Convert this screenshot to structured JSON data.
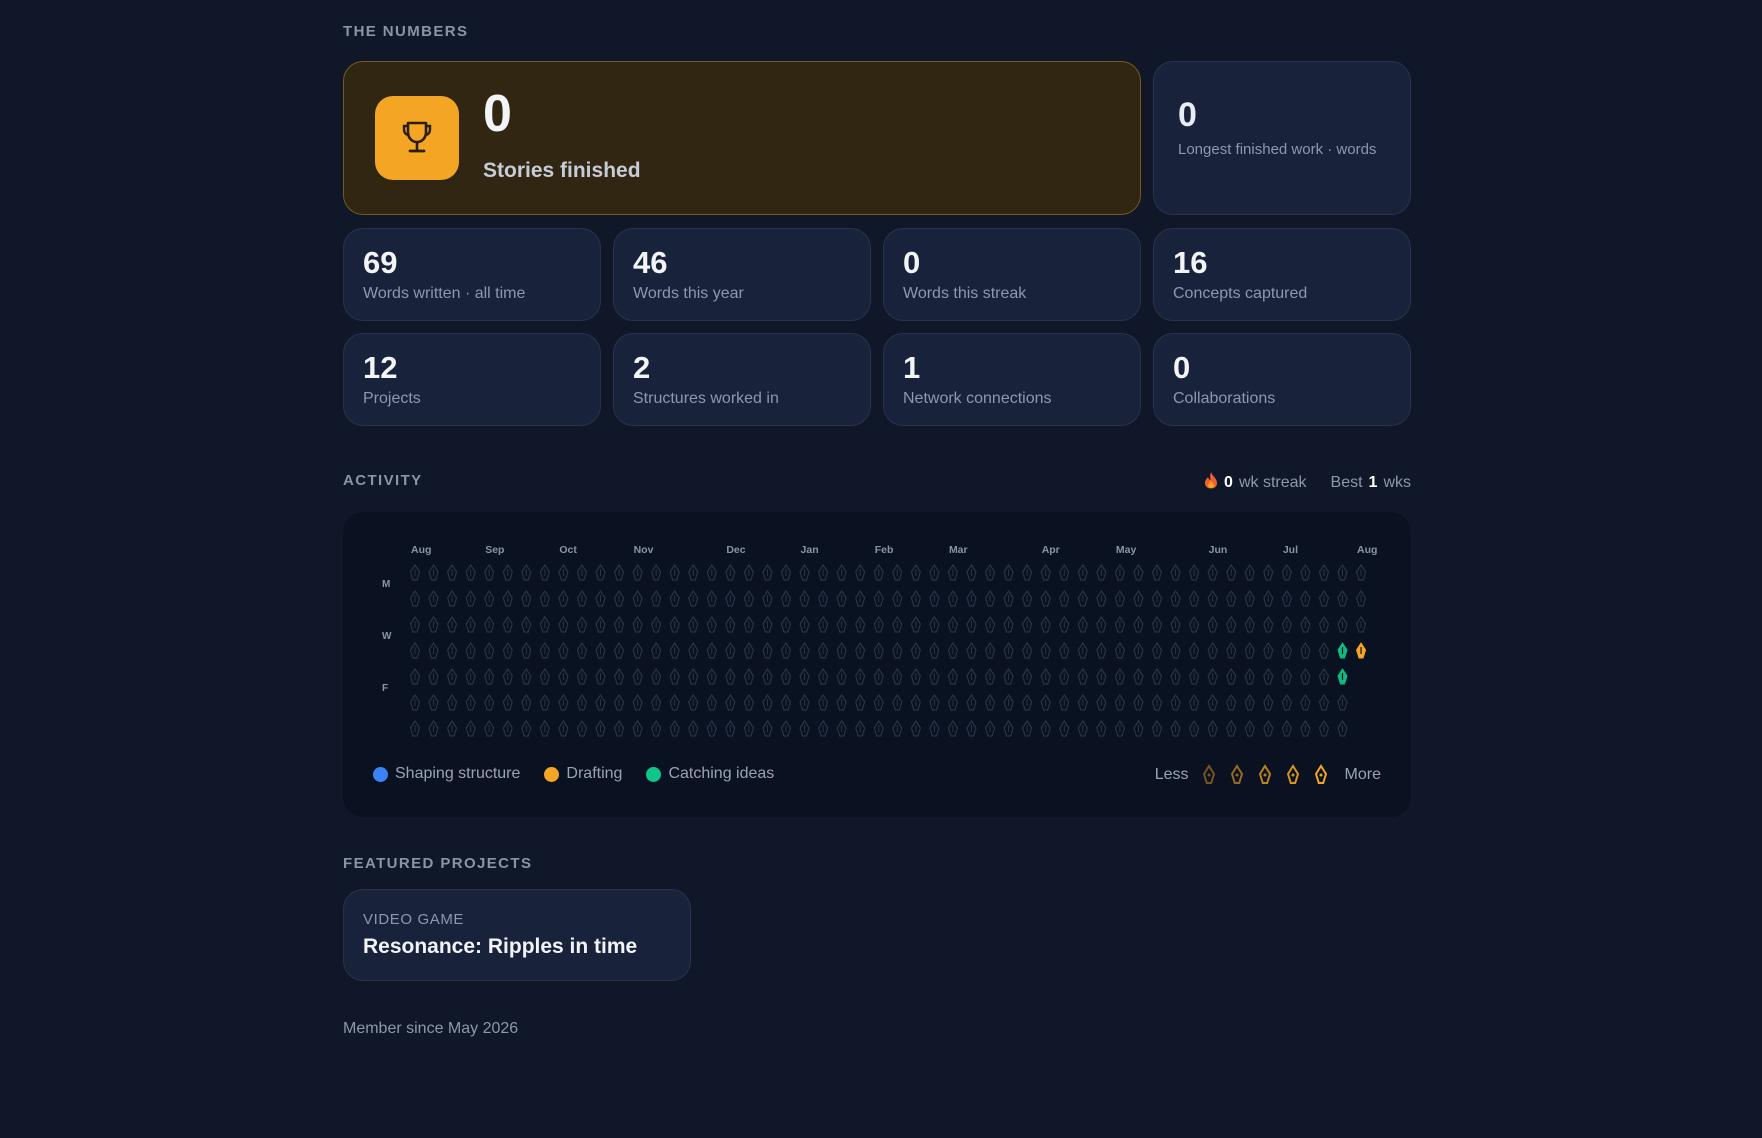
{
  "numbers": {
    "title": "THE NUMBERS",
    "hero": {
      "value": "0",
      "label": "Stories finished",
      "icon": "trophy-icon"
    },
    "longest": {
      "value": "0",
      "label": "Longest finished work · words"
    },
    "stats": [
      {
        "value": "69",
        "label": "Words written · all time"
      },
      {
        "value": "46",
        "label": "Words this year"
      },
      {
        "value": "0",
        "label": "Words this streak"
      },
      {
        "value": "16",
        "label": "Concepts captured"
      },
      {
        "value": "12",
        "label": "Projects"
      },
      {
        "value": "2",
        "label": "Structures worked in"
      },
      {
        "value": "1",
        "label": "Network connections"
      },
      {
        "value": "0",
        "label": "Collaborations"
      }
    ]
  },
  "activity": {
    "title": "ACTIVITY",
    "streak_icon": "flame-icon",
    "streak_value": "0",
    "streak_label": "wk streak",
    "best_prefix": "Best",
    "best_value": "1",
    "best_suffix": "wks",
    "months": [
      "Aug",
      "Sep",
      "Oct",
      "Nov",
      "Dec",
      "Jan",
      "Feb",
      "Mar",
      "Apr",
      "May",
      "Jun",
      "Jul",
      "Aug"
    ],
    "days": [
      "M",
      "W",
      "F"
    ],
    "active_cells": [
      {
        "week": 50,
        "day": 3,
        "type": "ideas"
      },
      {
        "week": 51,
        "day": 3,
        "type": "drafting"
      },
      {
        "week": 50,
        "day": 4,
        "type": "ideas"
      },
      {
        "week": 51,
        "day": 4,
        "type": "ideas_bright"
      }
    ],
    "legend": [
      {
        "label": "Shaping structure",
        "color": "#3b82f6"
      },
      {
        "label": "Drafting",
        "color": "#f5a524"
      },
      {
        "label": "Catching ideas",
        "color": "#10c58a"
      }
    ],
    "scale_less": "Less",
    "scale_more": "More",
    "colors": {
      "empty": "#2a3448",
      "ideas": "#10b981",
      "ideas_bright": "#34d3a4",
      "drafting": "#f5a524"
    }
  },
  "featured": {
    "title": "FEATURED PROJECTS",
    "projects": [
      {
        "kind": "VIDEO GAME",
        "name": "Resonance: Ripples in time"
      }
    ]
  },
  "member_since": "Member since May 2026"
}
